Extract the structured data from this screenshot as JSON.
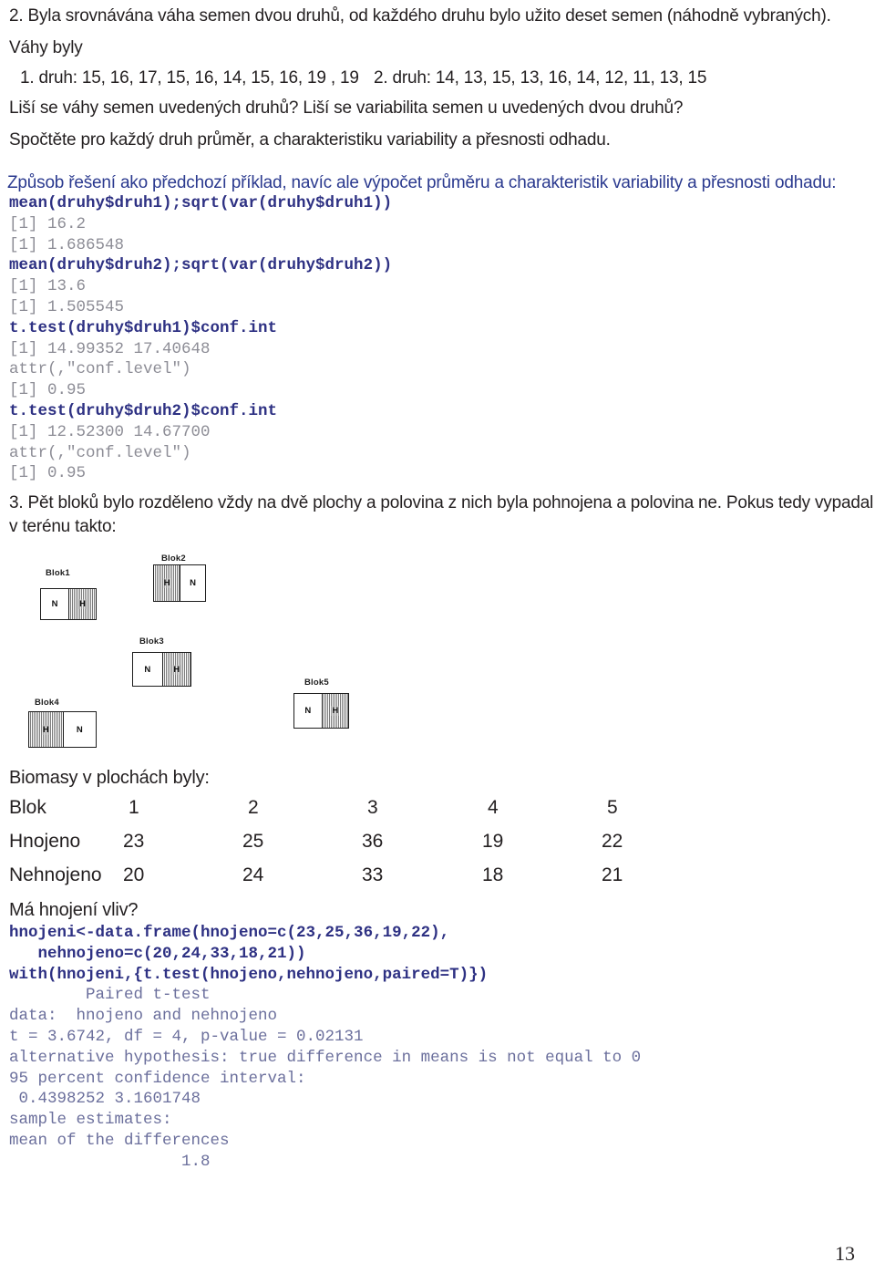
{
  "document": {
    "page_number": "13"
  },
  "exercise2": {
    "heading": "2. Byla srovnávána váha semen dvou druhů, od každého druhu bylo užito deset semen (náhodně vybraných).",
    "line_vahy": "Váhy byly",
    "druh1": "1. druh: 15, 16, 17, 15, 16, 14, 15, 16, 19 , 19",
    "druh2": "2. druh: 14, 13, 15, 13, 16, 14, 12, 11, 13, 15",
    "question": "Liší se váhy semen uvedených druhů? Liší se variabilita semen u uvedených dvou druhů?",
    "task": "Spočtěte pro každý druh průměr, a charakteristiku variability a přesnosti odhadu.",
    "solution_note": "Způsob řešení ako předchozí příklad, navíc ale výpočet průměru a charakteristik variability a přesnosti odhadu:",
    "console": [
      {
        "kind": "cmd",
        "text": "mean(druhy$druh1);sqrt(var(druhy$druh1))"
      },
      {
        "kind": "out",
        "text": "[1] 16.2"
      },
      {
        "kind": "out",
        "text": "[1] 1.686548"
      },
      {
        "kind": "cmd",
        "text": "mean(druhy$druh2);sqrt(var(druhy$druh2))"
      },
      {
        "kind": "out",
        "text": "[1] 13.6"
      },
      {
        "kind": "out",
        "text": "[1] 1.505545"
      },
      {
        "kind": "cmd",
        "text": "t.test(druhy$druh1)$conf.int"
      },
      {
        "kind": "out",
        "text": "[1] 14.99352 17.40648"
      },
      {
        "kind": "out",
        "text": "attr(,\"conf.level\")"
      },
      {
        "kind": "out",
        "text": "[1] 0.95"
      },
      {
        "kind": "cmd",
        "text": "t.test(druhy$druh2)$conf.int"
      },
      {
        "kind": "out",
        "text": "[1] 12.52300 14.67700"
      },
      {
        "kind": "out",
        "text": "attr(,\"conf.level\")"
      },
      {
        "kind": "out",
        "text": "[1] 0.95"
      }
    ]
  },
  "exercise3": {
    "heading_line1": "3. Pět bloků bylo rozděleno vždy na dvě plochy a polovina z nich byla pohnojena a polovina ne. Pokus tedy vypadal",
    "heading_line2": "v terénu takto:",
    "blocks": [
      {
        "label": "Blok1",
        "left": "N",
        "right": "H",
        "left_fill": "white",
        "right_fill": "hatch"
      },
      {
        "label": "Blok2",
        "left": "H",
        "right": "N",
        "left_fill": "hatch",
        "right_fill": "white"
      },
      {
        "label": "Blok3",
        "left": "N",
        "right": "H",
        "left_fill": "white",
        "right_fill": "hatch"
      },
      {
        "label": "Blok4",
        "left": "H",
        "right": "N",
        "left_fill": "hatch",
        "right_fill": "white"
      },
      {
        "label": "Blok5",
        "left": "N",
        "right": "H",
        "left_fill": "white",
        "right_fill": "hatch"
      }
    ],
    "biomass_intro": "Biomasy v plochách byly:",
    "table": {
      "row_labels": [
        "Blok",
        "Hnojeno",
        "Nehnojeno"
      ],
      "header": [
        "1",
        "2",
        "3",
        "4",
        "5"
      ],
      "hnojeno": [
        "23",
        "25",
        "36",
        "19",
        "22"
      ],
      "nehnojeno": [
        "20",
        "24",
        "33",
        "18",
        "21"
      ]
    },
    "question": "Má hnojení vliv?",
    "console": [
      {
        "kind": "cmd",
        "text": "hnojeni<-data.frame(hnojeno=c(23,25,36,19,22),"
      },
      {
        "kind": "cmd",
        "text": "   nehnojeno=c(20,24,33,18,21))"
      },
      {
        "kind": "cmd",
        "text": "with(hnojeni,{t.test(hnojeno,nehnojeno,paired=T)})"
      },
      {
        "kind": "out2",
        "text": "        Paired t-test"
      },
      {
        "kind": "out2",
        "text": "data:  hnojeno and nehnojeno"
      },
      {
        "kind": "out2",
        "text": "t = 3.6742, df = 4, p-value = 0.02131"
      },
      {
        "kind": "out2",
        "text": "alternative hypothesis: true difference in means is not equal to 0"
      },
      {
        "kind": "out2",
        "text": "95 percent confidence interval:"
      },
      {
        "kind": "out2",
        "text": " 0.4398252 3.1601748"
      },
      {
        "kind": "out2",
        "text": "sample estimates:"
      },
      {
        "kind": "out2",
        "text": "mean of the differences"
      },
      {
        "kind": "out2",
        "text": "                  1.8"
      }
    ]
  },
  "colors": {
    "text": "#231f20",
    "blue_prose": "#2b3a8f",
    "command": "#2e3183",
    "output": "#8d8d96",
    "output_blue": "#6b6f9c",
    "hatch": "#cfcfcf"
  }
}
